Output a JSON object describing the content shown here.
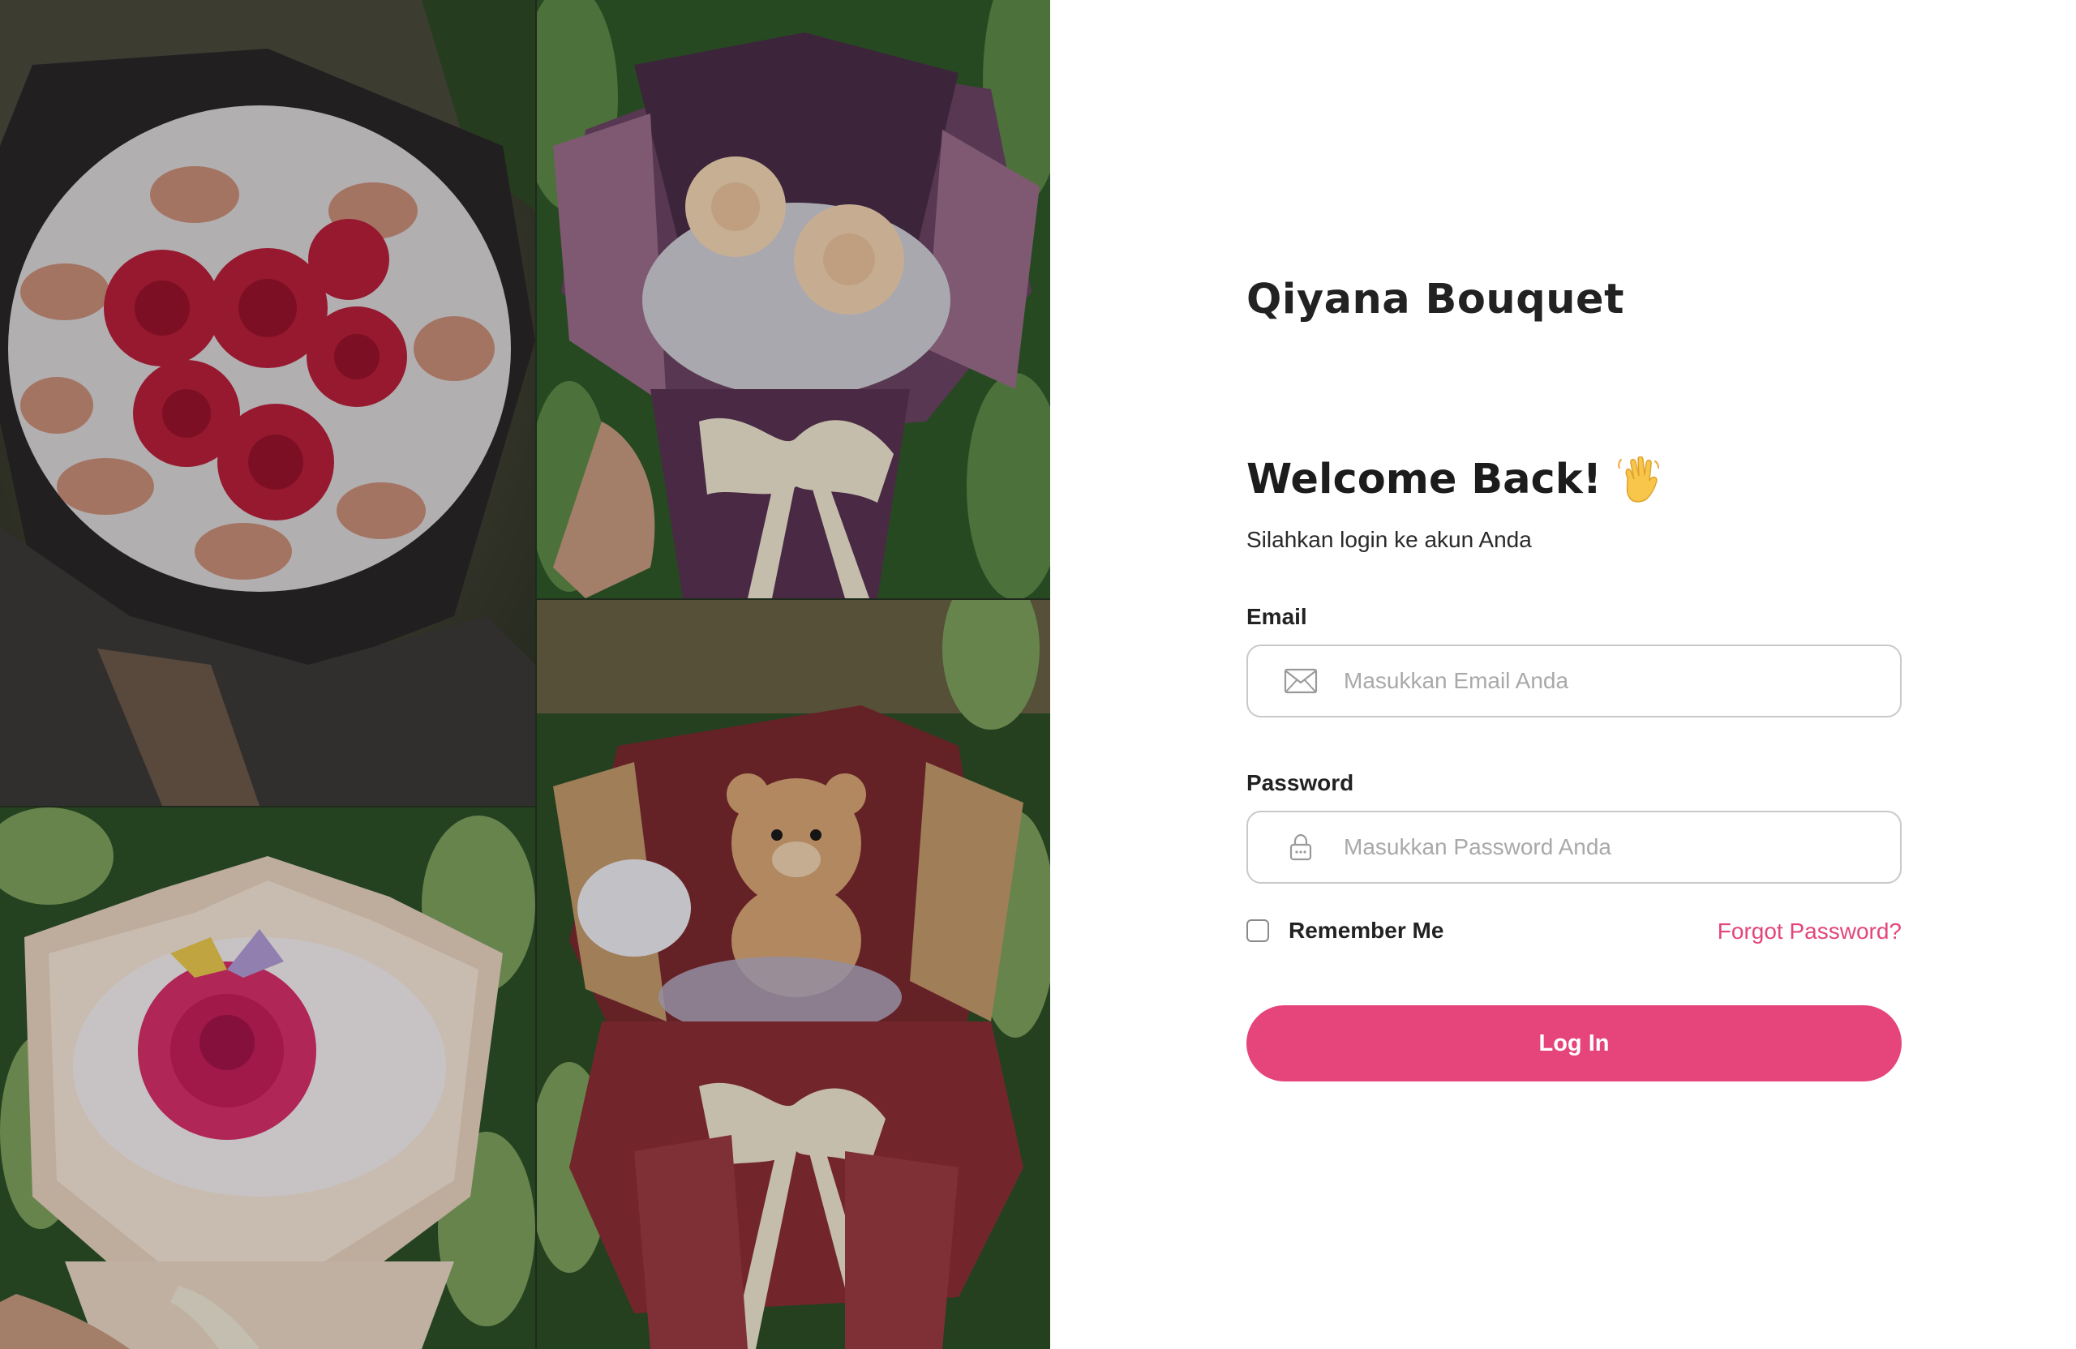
{
  "brand": {
    "name": "Qiyana Bouquet"
  },
  "login": {
    "heading": "Welcome Back!",
    "heading_icon": "waving-hand-icon",
    "subtitle": "Silahkan login ke akun Anda",
    "email": {
      "label": "Email",
      "placeholder": "Masukkan Email Anda",
      "value": "",
      "icon": "envelope-icon"
    },
    "password": {
      "label": "Password",
      "placeholder": "Masukkan Password Anda",
      "value": "",
      "icon": "lock-icon"
    },
    "remember_label": "Remember Me",
    "remember_checked": false,
    "forgot_label": "Forgot Password?",
    "submit_label": "Log In"
  },
  "gallery": {
    "photos": [
      "bouquet-red-roses-money",
      "bouquet-cream-peonies-purple",
      "bouquet-pink-rose-butterfly",
      "bouquet-teddy-bear-red"
    ]
  },
  "colors": {
    "accent": "#e5457a",
    "link": "#e3457a",
    "text": "#222222",
    "placeholder": "#a9a9a9",
    "border": "#c9c9c9"
  }
}
